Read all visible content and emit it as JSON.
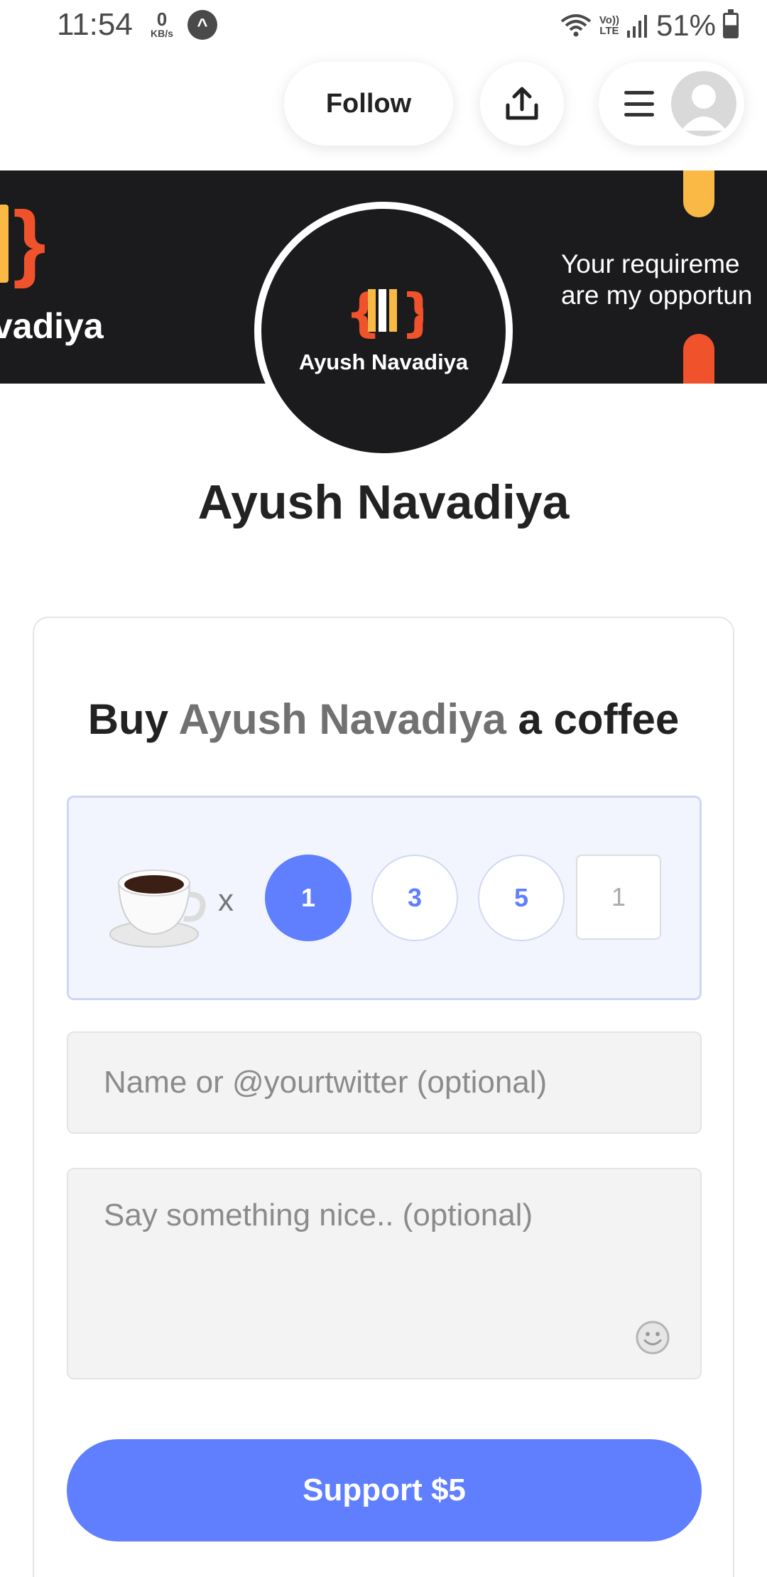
{
  "status_bar": {
    "time": "11:54",
    "net_speed_value": "0",
    "net_speed_unit": "KB/s",
    "volte_top": "Vo))",
    "volte_bottom": "LTE",
    "battery": "51%"
  },
  "nav": {
    "follow_label": "Follow"
  },
  "banner": {
    "name_fragment": "vadiya",
    "tagline_line1": "Your requireme",
    "tagline_line2": "are my opportun",
    "colors": {
      "background": "#1b1a1c",
      "orange": "#f0522b",
      "yellow": "#f9b944"
    }
  },
  "profile": {
    "logo_text": "Ayush Navadiya",
    "name": "Ayush Navadiya"
  },
  "card": {
    "title_prefix": "Buy",
    "title_name": "Ayush Navadiya",
    "title_suffix": "a coffee",
    "multiplier": "x",
    "quantity_options": [
      "1",
      "3",
      "5"
    ],
    "selected_quantity": "1",
    "custom_quantity": "1",
    "name_placeholder": "Name or @yourtwitter (optional)",
    "message_placeholder": "Say something nice.. (optional)",
    "support_label": "Support $5",
    "accent_color": "#5f7fff"
  }
}
